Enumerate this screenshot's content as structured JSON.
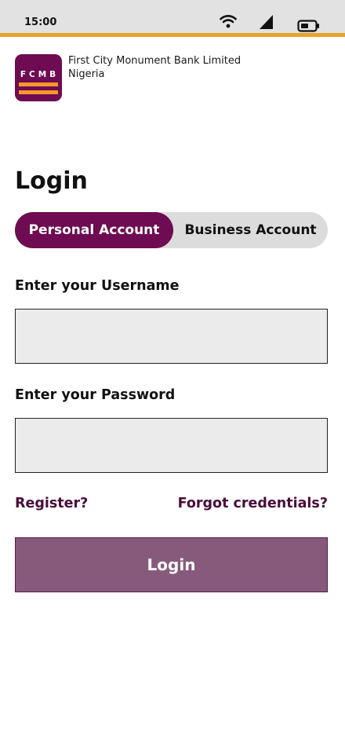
{
  "status_bar": {
    "time": "15:00",
    "icons": [
      "wifi-icon",
      "signal-icon",
      "battery-icon"
    ],
    "accent_color": "#e8a12c"
  },
  "brand": {
    "logo_text": "FCMB",
    "name_line1": "First City Monument Bank Limited",
    "name_line2": "Nigeria",
    "brand_color": "#6e0b52",
    "logo_accent_color": "#f39a2a"
  },
  "login": {
    "title": "Login",
    "account_tabs": [
      {
        "label": "Personal Account",
        "selected": true
      },
      {
        "label": "Business Account",
        "selected": false
      }
    ],
    "username_label": "Enter your Username",
    "username_value": "",
    "password_label": "Enter your Password",
    "password_value": "",
    "register_link": "Register?",
    "forgot_link": "Forgot credentials?",
    "submit_label": "Login",
    "submit_color": "#875a7b"
  }
}
